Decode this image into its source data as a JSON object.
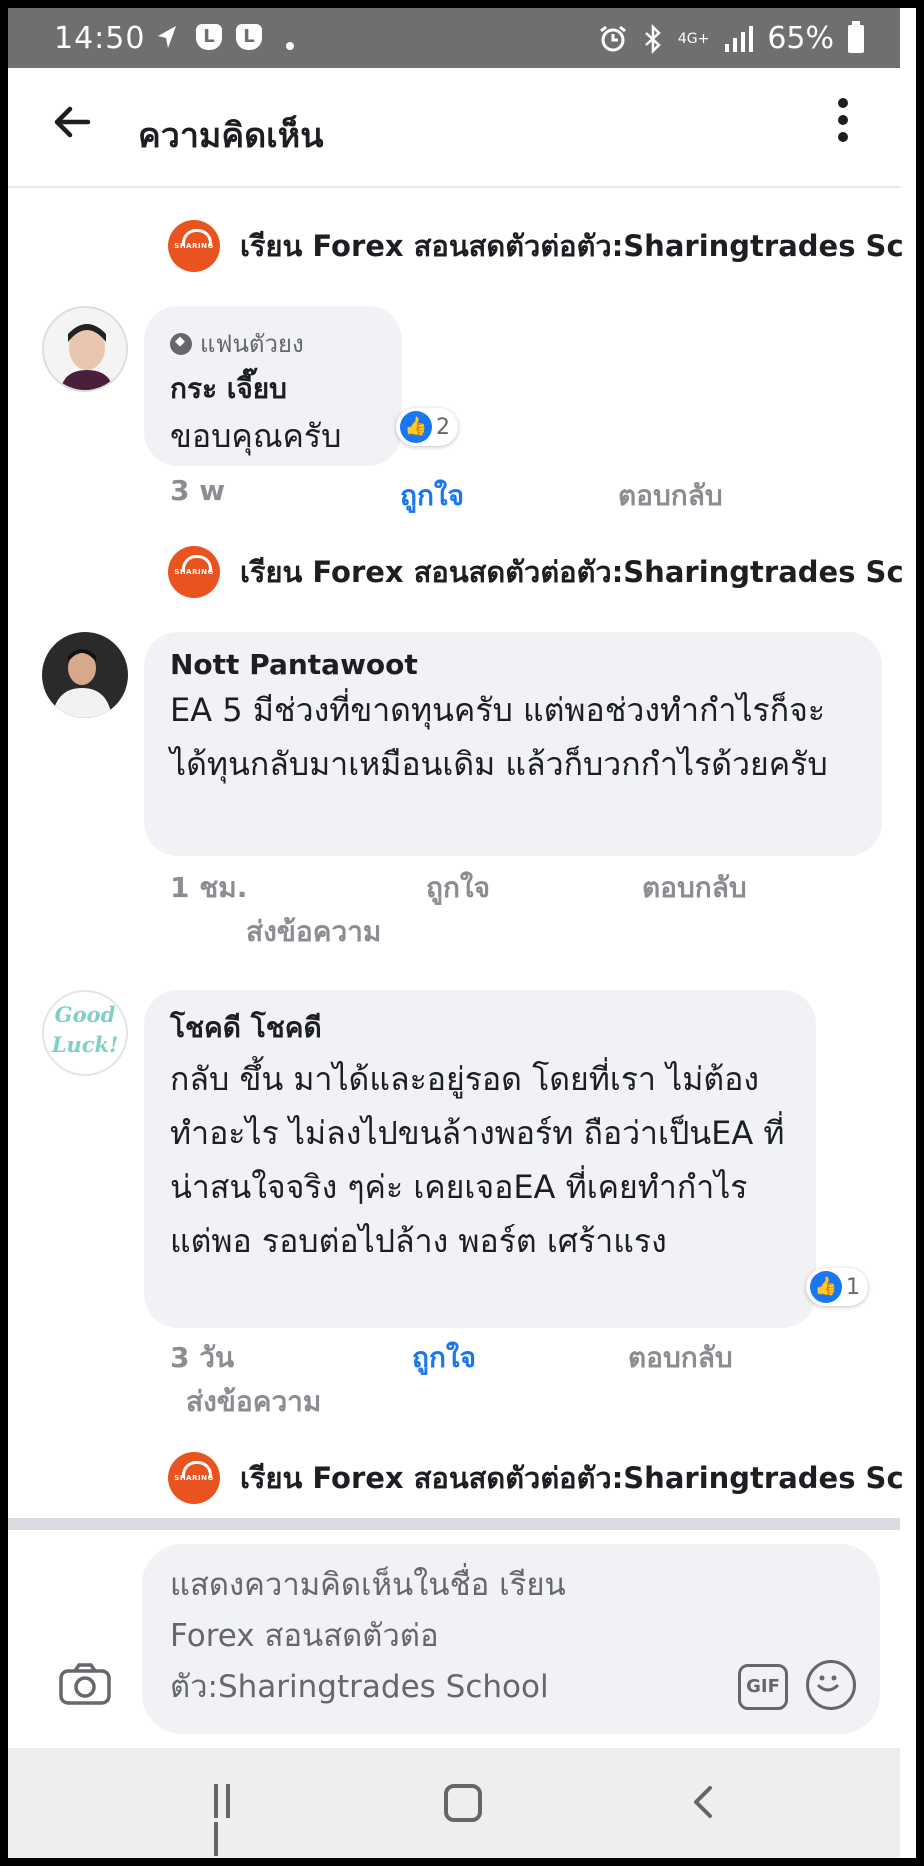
{
  "status_bar": {
    "time": "14:50",
    "network": "4G+",
    "battery": "65%",
    "icons": [
      "location-icon",
      "badge-l-icon",
      "badge-l-icon",
      "notification-dot-icon",
      "alarm-icon",
      "bluetooth-icon",
      "signal-icon",
      "battery-icon"
    ],
    "badge_letter": "L"
  },
  "header": {
    "title": "ความคิดเห็น"
  },
  "page": {
    "name": "เรียน Forex สอนสดตัวต่อตัว:Sharingtrades Sc",
    "logo_text": "SHARING",
    "color": "#e8531f"
  },
  "comments": [
    {
      "badge": "แฟนตัวยง",
      "author": "กระ เจี๊ยบ",
      "text": "ขอบคุณครับ",
      "reaction_count": "2",
      "time": "3 w",
      "like_label": "ถูกใจ",
      "reply_label": "ตอบกลับ",
      "liked": true
    },
    {
      "author": "Nott Pantawoot",
      "text": "EA 5 มีช่วงที่ขาดทุนครับ แต่พอช่วงทำกำไรก็จะได้ทุนกลับมาเหมือนเดิม แล้วก็บวกกำไรด้วยครับ",
      "time": "1 ชม.",
      "like_label": "ถูกใจ",
      "reply_label": "ตอบกลับ",
      "message_label": "ส่งข้อความ",
      "liked": false
    },
    {
      "author": "โชคดี โชคดี",
      "avatar_text": "Good Luck!",
      "text": "กลับ ขึ้น มาได้และอยู่รอด โดยที่เรา ไม่ต้องทำอะไร ไม่ลงไปขนล้างพอร์ท ถือว่าเป็นEA ที่น่าสนใจจริง ๆค่ะ เคยเจอEA ที่เคยทำกำไร แต่พอ รอบต่อไปล้าง พอร์ต เศร้าแรง",
      "reaction_count": "1",
      "time": "3 วัน",
      "like_label": "ถูกใจ",
      "reply_label": "ตอบกลับ",
      "message_label": "ส่งข้อความ",
      "liked": true
    }
  ],
  "composer": {
    "placeholder": "แสดงความคิดเห็นในชื่อ เรียน Forex สอนสดตัวต่อตัว:Sharingtrades School",
    "gif_label": "GIF"
  },
  "colors": {
    "like_blue": "#1877f2",
    "bubble_bg": "#f0f2f5",
    "status_bar_bg": "#6f6f6f"
  }
}
